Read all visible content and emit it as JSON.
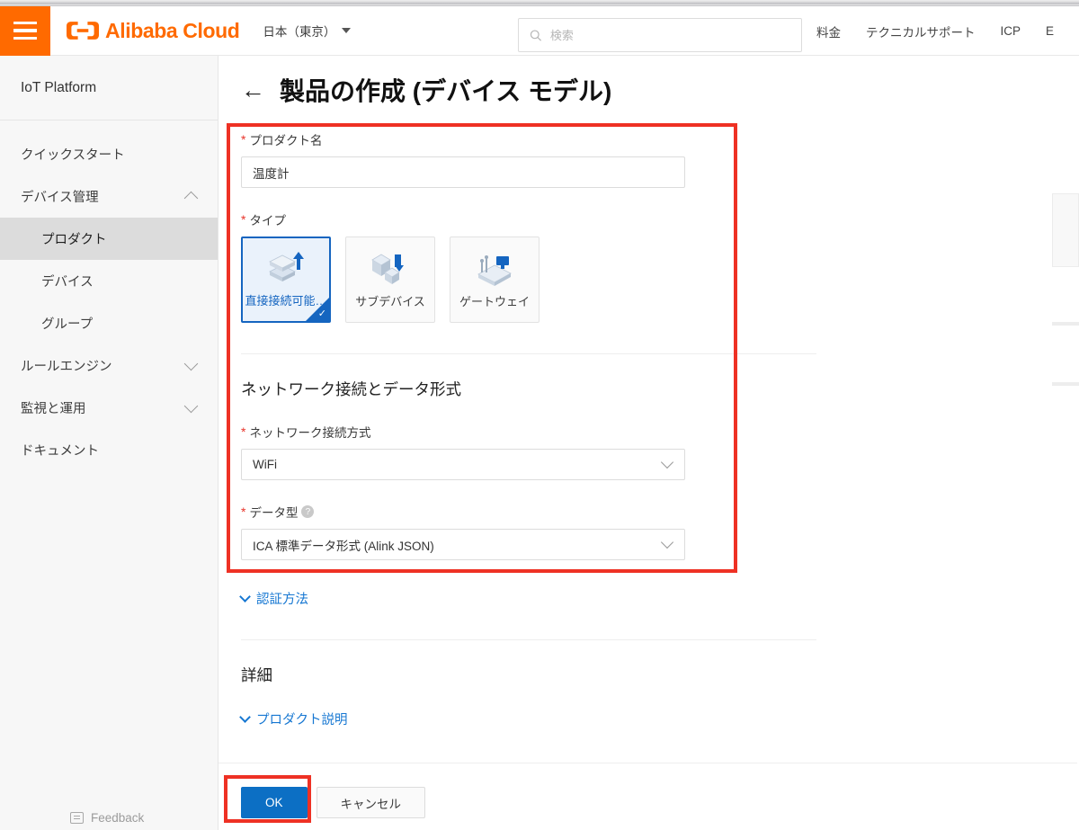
{
  "header": {
    "logo_text": "Alibaba Cloud",
    "logo_icon": "alibaba-cloud-logo-icon",
    "menu_icon": "hamburger-menu-icon",
    "region": "日本（東京）",
    "search": {
      "placeholder": "検索",
      "value": "",
      "icon": "search-icon"
    },
    "nav": [
      {
        "label": "料金"
      },
      {
        "label": "テクニカルサポート"
      },
      {
        "label": "ICP"
      },
      {
        "label": "E"
      }
    ]
  },
  "sidebar": {
    "title": "IoT Platform",
    "items": [
      {
        "label": "クイックスタート",
        "type": "item",
        "expandable": false,
        "active": false
      },
      {
        "label": "デバイス管理",
        "type": "group",
        "expandable": true,
        "expanded": true,
        "active": false
      },
      {
        "label": "プロダクト",
        "type": "sub",
        "expandable": false,
        "active": true
      },
      {
        "label": "デバイス",
        "type": "sub",
        "expandable": false,
        "active": false
      },
      {
        "label": "グループ",
        "type": "sub",
        "expandable": false,
        "active": false
      },
      {
        "label": "ルールエンジン",
        "type": "group",
        "expandable": true,
        "expanded": false,
        "active": false
      },
      {
        "label": "監視と運用",
        "type": "group",
        "expandable": true,
        "expanded": false,
        "active": false
      },
      {
        "label": "ドキュメント",
        "type": "item",
        "expandable": false,
        "active": false
      }
    ],
    "feedback": {
      "label": "Feedback",
      "icon": "feedback-icon"
    }
  },
  "main": {
    "back_icon": "back-arrow-icon",
    "title": "製品の作成 (デバイス モデル)",
    "product_name": {
      "label": "プロダクト名",
      "required": true,
      "value": "温度計",
      "placeholder": ""
    },
    "type": {
      "label": "タイプ",
      "required": true,
      "options": [
        {
          "label": "直接接続可能…",
          "icon": "direct-connect-device-icon",
          "selected": true
        },
        {
          "label": "サブデバイス",
          "icon": "sub-device-icon",
          "selected": false
        },
        {
          "label": "ゲートウェイ",
          "icon": "gateway-icon",
          "selected": false
        }
      ]
    },
    "network_section": {
      "heading": "ネットワーク接続とデータ形式",
      "connection": {
        "label": "ネットワーク接続方式",
        "required": true,
        "value": "WiFi"
      },
      "data_format": {
        "label": "データ型",
        "required": true,
        "help_icon": "help-question-icon",
        "value": "ICA 標準データ形式 (Alink JSON)"
      }
    },
    "auth_link": {
      "label": "認証方法",
      "icon": "chevron-down-icon"
    },
    "details_heading": "詳細",
    "description_link": {
      "label": "プロダクト説明",
      "icon": "chevron-down-icon"
    },
    "buttons": {
      "ok": "OK",
      "cancel": "キャンセル"
    }
  },
  "annotations": {
    "highlight_color": "#ee3124",
    "boxes": [
      {
        "name": "form-fields-highlight"
      },
      {
        "name": "ok-button-highlight"
      }
    ]
  },
  "colors": {
    "brand_orange": "#ff6a00",
    "primary_blue": "#0c6fc4",
    "link_blue": "#1677d2",
    "selected_border": "#1565c0",
    "required_red": "#e8342a"
  }
}
